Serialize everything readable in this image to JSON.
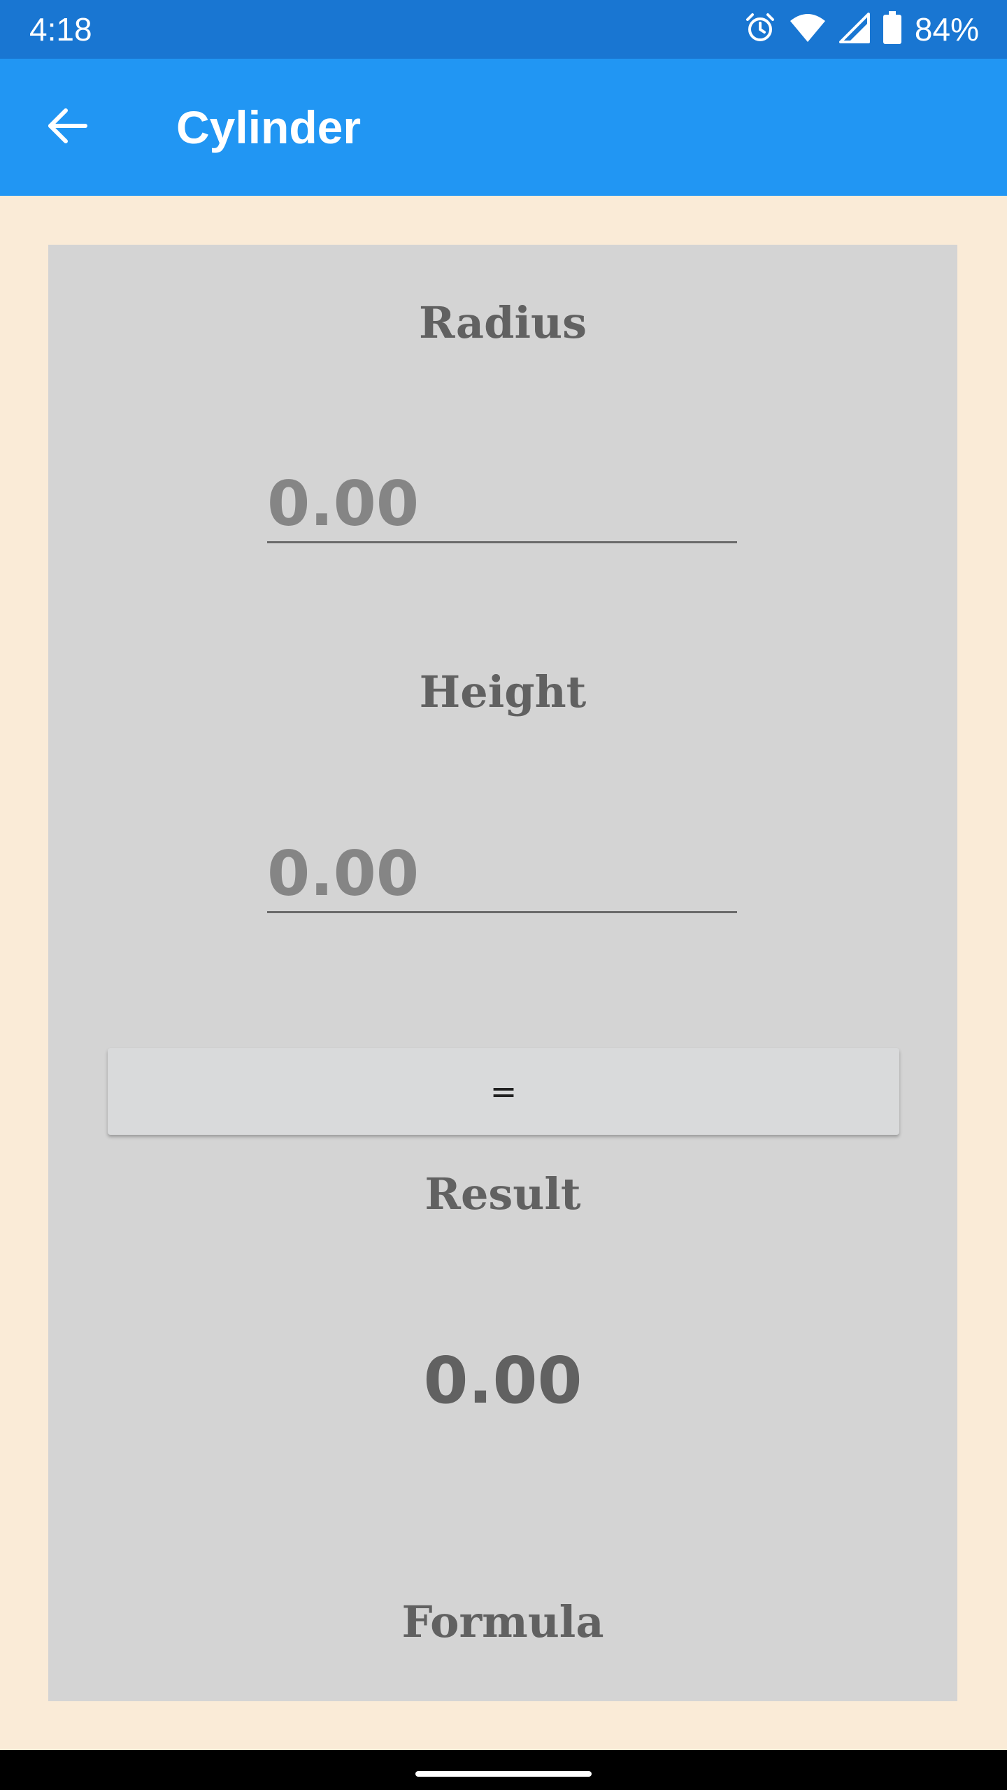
{
  "status_bar": {
    "time": "4:18",
    "battery": "84%",
    "icons": [
      "alarm-icon",
      "wifi-icon",
      "signal-icon",
      "battery-icon"
    ]
  },
  "app_bar": {
    "title": "Cylinder",
    "back_icon": "arrow-back-icon"
  },
  "form": {
    "radius_label": "Radius",
    "radius_placeholder": "0.00",
    "height_label": "Height",
    "height_placeholder": "0.00",
    "equals_label": "=",
    "result_label": "Result",
    "result_value": "0.00",
    "formula_label": "Formula"
  },
  "colors": {
    "status_bar": "#1976d2",
    "app_bar": "#2196f3",
    "background": "#faebd7",
    "card": "#d4d4d4",
    "label_text": "#616161"
  }
}
